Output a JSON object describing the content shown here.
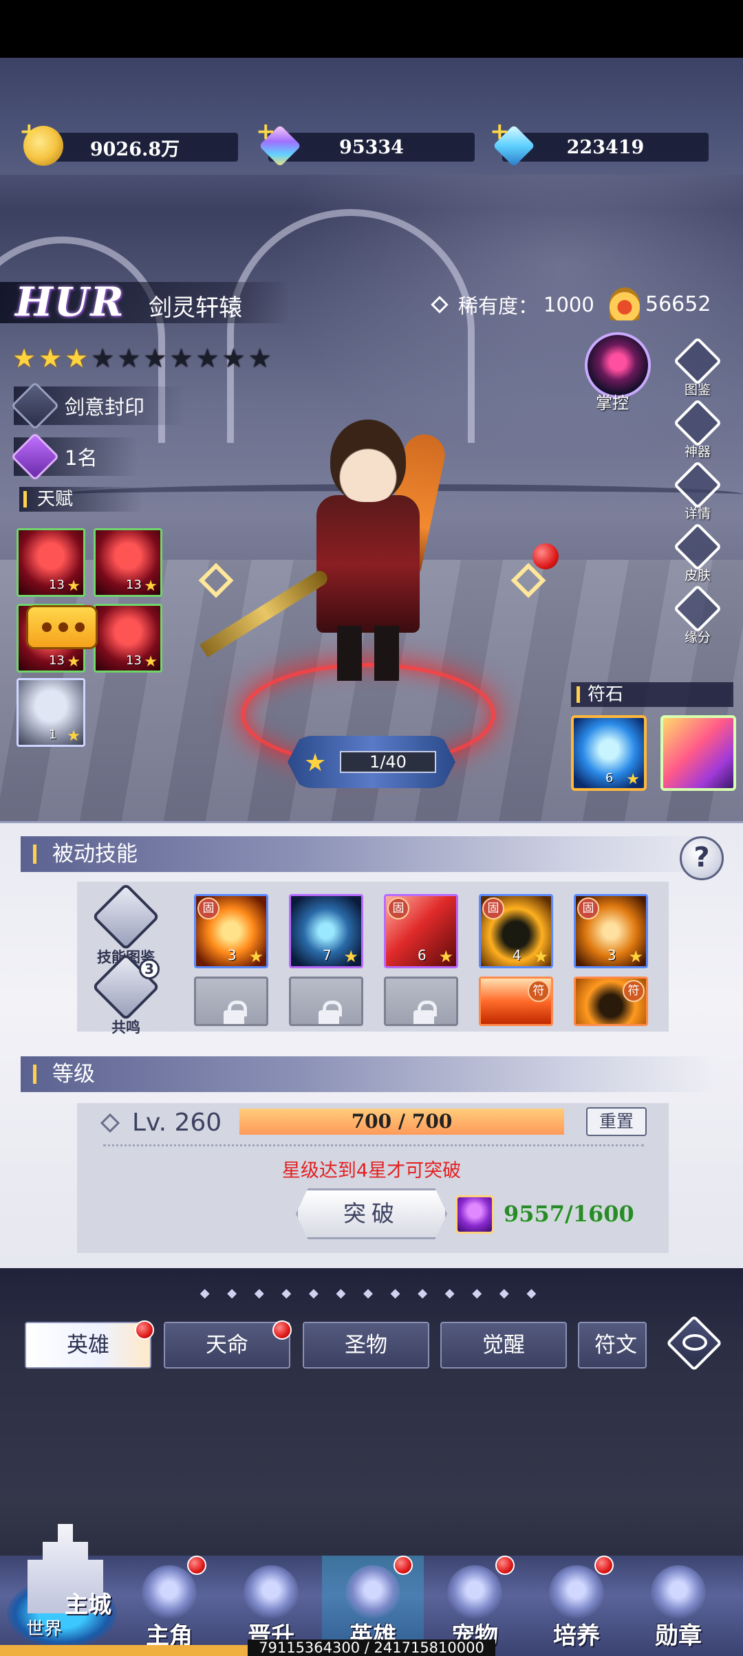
{
  "currencies": [
    {
      "id": "gold",
      "value": "9026.8万",
      "color": "#f5c441"
    },
    {
      "id": "crystal",
      "value": "95334",
      "color": "#c8a0ff"
    },
    {
      "id": "diamond",
      "value": "223419",
      "color": "#5fd0ff"
    }
  ],
  "hero": {
    "grade": "HUR",
    "name": "剑灵轩辕",
    "rarity_label": "稀有度：",
    "rarity_value": "1000",
    "power": "56652",
    "stars_total": 10,
    "stars_filled": 3,
    "faction": "剑意封印",
    "rank": "1名",
    "talent_label": "天赋",
    "control_label": "掌控"
  },
  "talents": [
    {
      "level": "13",
      "color": "red"
    },
    {
      "level": "13",
      "color": "red"
    },
    {
      "level": "13",
      "color": "red"
    },
    {
      "level": "13",
      "color": "red"
    },
    {
      "level": "1",
      "color": "white"
    }
  ],
  "side_buttons": [
    {
      "label": "图鉴",
      "icon": "book-icon"
    },
    {
      "label": "神器",
      "icon": "artifact-icon"
    },
    {
      "label": "详情",
      "icon": "detail-icon"
    },
    {
      "label": "皮肤",
      "icon": "skin-icon"
    },
    {
      "label": "缘分",
      "icon": "heart-icon"
    }
  ],
  "runes": {
    "label": "符石",
    "items": [
      {
        "level": "6"
      },
      {
        "level": ""
      }
    ]
  },
  "awaken": {
    "progress": "1/40"
  },
  "passive": {
    "title": "被动技能",
    "help": "?",
    "codex_label": "技能图鉴",
    "resonance_label": "共鸣",
    "resonance_count": "3",
    "fixed_tag": "固",
    "rune_tag": "符",
    "skills_row1": [
      {
        "level": "3",
        "tagged": true
      },
      {
        "level": "7",
        "tagged": false
      },
      {
        "level": "6",
        "tagged": true
      },
      {
        "level": "4",
        "tagged": true
      },
      {
        "level": "3",
        "tagged": true
      }
    ]
  },
  "level": {
    "title": "等级",
    "label": "Lv. 260",
    "exp": "700 / 700",
    "exp_fraction": 1.0,
    "reset_label": "重置",
    "star_message": "星级达到4星才可突破",
    "break_label": "突破",
    "material_count": "9557/1600"
  },
  "tabs": [
    {
      "label": "英雄",
      "active": true,
      "badge": true
    },
    {
      "label": "天命",
      "active": false,
      "badge": true
    },
    {
      "label": "圣物",
      "active": false,
      "badge": false
    },
    {
      "label": "觉醒",
      "active": false,
      "badge": false
    },
    {
      "label": "符文",
      "active": false,
      "badge": false
    }
  ],
  "nav": {
    "castle_label": "主城",
    "world_label": "世界",
    "items": [
      {
        "label": "主角",
        "badge": true,
        "active": false
      },
      {
        "label": "晋升",
        "badge": false,
        "active": false
      },
      {
        "label": "英雄",
        "badge": true,
        "active": true
      },
      {
        "label": "宠物",
        "badge": true,
        "active": false
      },
      {
        "label": "培养",
        "badge": true,
        "active": false
      },
      {
        "label": "勋章",
        "badge": false,
        "active": false
      }
    ]
  },
  "footer_exp": "79115364300 / 241715810000"
}
